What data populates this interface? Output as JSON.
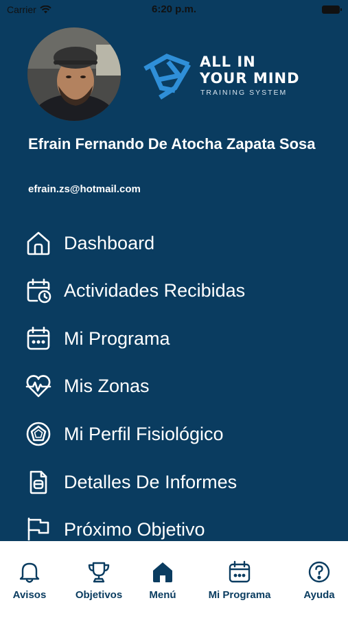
{
  "status_bar": {
    "carrier": "Carrier",
    "time": "6:20 p.m."
  },
  "profile": {
    "name": "Efrain Fernando De Atocha Zapata Sosa",
    "email": "efrain.zs@hotmail.com"
  },
  "logo": {
    "line1": "ALL IN",
    "line2": "YOUR MIND",
    "line3": "TRAINING SYSTEM"
  },
  "menu": {
    "items": [
      {
        "label": "Dashboard",
        "icon": "home-icon"
      },
      {
        "label": "Actividades Recibidas",
        "icon": "calendar-clock-icon"
      },
      {
        "label": "Mi Programa",
        "icon": "calendar-icon"
      },
      {
        "label": "Mis Zonas",
        "icon": "heart-pulse-icon"
      },
      {
        "label": "Mi Perfil Fisiológico",
        "icon": "pentagon-badge-icon"
      },
      {
        "label": "Detalles De Informes",
        "icon": "document-icon"
      },
      {
        "label": "Próximo Objetivo",
        "icon": "flag-icon"
      }
    ]
  },
  "tabbar": {
    "items": [
      {
        "label": "Avisos",
        "icon": "bell-icon"
      },
      {
        "label": "Objetivos",
        "icon": "trophy-icon"
      },
      {
        "label": "Menú",
        "icon": "home-icon",
        "active": true
      },
      {
        "label": "Mi Programa",
        "icon": "calendar-icon"
      },
      {
        "label": "Ayuda",
        "icon": "help-icon"
      }
    ]
  },
  "colors": {
    "background": "#0a3c60",
    "accent": "#2f8fd8",
    "tabbar": "#ffffff"
  }
}
